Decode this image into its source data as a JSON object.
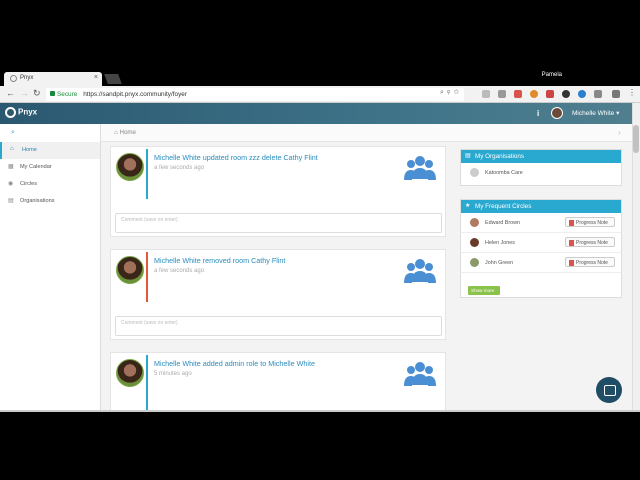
{
  "browser": {
    "tab_title": "Pnyx",
    "tab_close": "×",
    "profile_name": "Pamela",
    "secure_label": "Secure",
    "url": "https://sandpit.pnyx.community/foyer"
  },
  "app": {
    "logo_text": "Pnyx",
    "user_name": "Michelle White",
    "info": "i"
  },
  "sidebar": {
    "items": [
      {
        "label": "Home",
        "icon": "home-icon"
      },
      {
        "label": "My Calendar",
        "icon": "calendar-icon"
      },
      {
        "label": "Circles",
        "icon": "circles-icon"
      },
      {
        "label": "Organisations",
        "icon": "organisations-icon"
      }
    ]
  },
  "breadcrumb": {
    "label": "Home"
  },
  "feed": [
    {
      "title": "Michelle White updated room zzz delete Cathy Flint",
      "time": "a few seconds ago",
      "comment_placeholder": "Comment (save on enter)",
      "bar_color": "#29a8d0"
    },
    {
      "title": "Michelle White removed room Cathy Flint",
      "time": "a few seconds ago",
      "comment_placeholder": "Comment (save on enter)",
      "bar_color": "#e05a3a"
    },
    {
      "title": "Michelle White added admin role to Michelle White",
      "time": "5 minutes ago",
      "comment_placeholder": "",
      "bar_color": "#29a8d0"
    }
  ],
  "organisations_panel": {
    "title": "My Organisations",
    "items": [
      {
        "label": "Katoomba Care"
      }
    ]
  },
  "circles_panel": {
    "title": "My Frequent Circles",
    "button_label": "Progress Note",
    "items": [
      {
        "label": "Edward Brown"
      },
      {
        "label": "Helen Jones"
      },
      {
        "label": "John Green"
      }
    ],
    "show_more": "Show more"
  },
  "colors": {
    "accent": "#29a8d0",
    "header": "#3e7388",
    "show_more": "#8bc34a"
  }
}
